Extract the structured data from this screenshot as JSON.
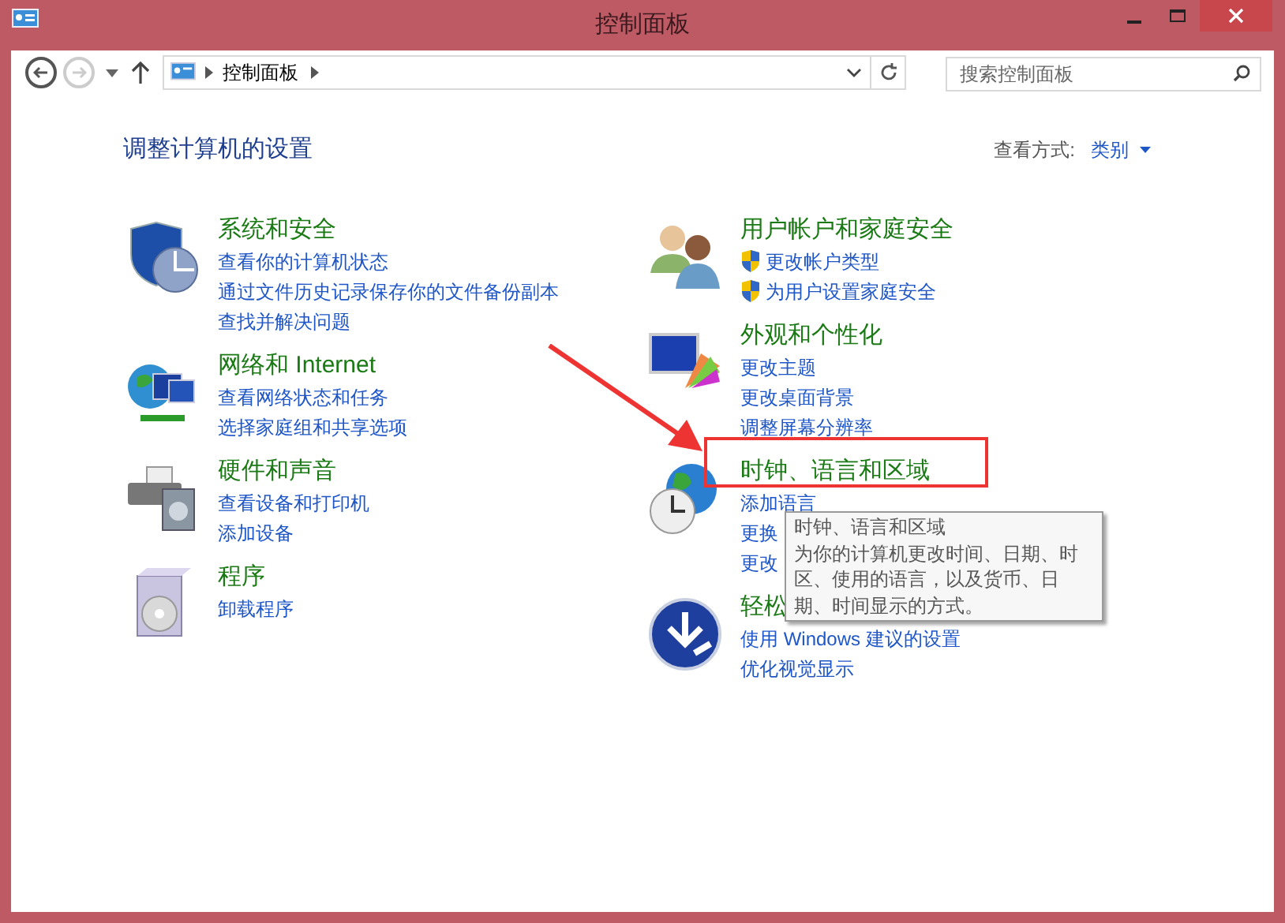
{
  "window": {
    "title": "控制面板"
  },
  "nav": [
    {
      "kind": "back",
      "disabled": false
    },
    {
      "kind": "forward",
      "disabled": true
    }
  ],
  "address": {
    "breadcrumb": [
      "控制面板"
    ]
  },
  "search": {
    "placeholder": "搜索控制面板"
  },
  "header": {
    "title": "调整计算机的设置",
    "view_by_label": "查看方式:",
    "view_by_value": "类别"
  },
  "columns": [
    [
      {
        "kind": "security",
        "title": "系统和安全",
        "links": [
          {
            "text": "查看你的计算机状态",
            "uac": false
          },
          {
            "text": "通过文件历史记录保存你的文件备份副本",
            "uac": false
          },
          {
            "text": "查找并解决问题",
            "uac": false
          }
        ]
      },
      {
        "kind": "network",
        "title": "网络和 Internet",
        "links": [
          {
            "text": "查看网络状态和任务",
            "uac": false
          },
          {
            "text": "选择家庭组和共享选项",
            "uac": false
          }
        ]
      },
      {
        "kind": "hardware",
        "title": "硬件和声音",
        "links": [
          {
            "text": "查看设备和打印机",
            "uac": false
          },
          {
            "text": "添加设备",
            "uac": false
          }
        ]
      },
      {
        "kind": "programs",
        "title": "程序",
        "links": [
          {
            "text": "卸载程序",
            "uac": false
          }
        ]
      }
    ],
    [
      {
        "kind": "users",
        "title": "用户帐户和家庭安全",
        "links": [
          {
            "text": "更改帐户类型",
            "uac": true
          },
          {
            "text": "为用户设置家庭安全",
            "uac": true
          }
        ]
      },
      {
        "kind": "appearance",
        "title": "外观和个性化",
        "links": [
          {
            "text": "更改主题",
            "uac": false
          },
          {
            "text": "更改桌面背景",
            "uac": false
          },
          {
            "text": "调整屏幕分辨率",
            "uac": false
          }
        ]
      },
      {
        "kind": "clock",
        "title": "时钟、语言和区域",
        "links": [
          {
            "text": "添加语言",
            "uac": false
          },
          {
            "text": "更换",
            "uac": false
          },
          {
            "text": "更改",
            "uac": false
          }
        ]
      },
      {
        "kind": "access",
        "title": "轻松",
        "links": [
          {
            "text": "使用 Windows 建议的设置",
            "uac": false
          },
          {
            "text": "优化视觉显示",
            "uac": false
          }
        ]
      }
    ]
  ],
  "tooltip": {
    "title": "时钟、语言和区域",
    "text": "为你的计算机更改时间、日期、时区、使用的语言，以及货币、日期、时间显示的方式。"
  }
}
